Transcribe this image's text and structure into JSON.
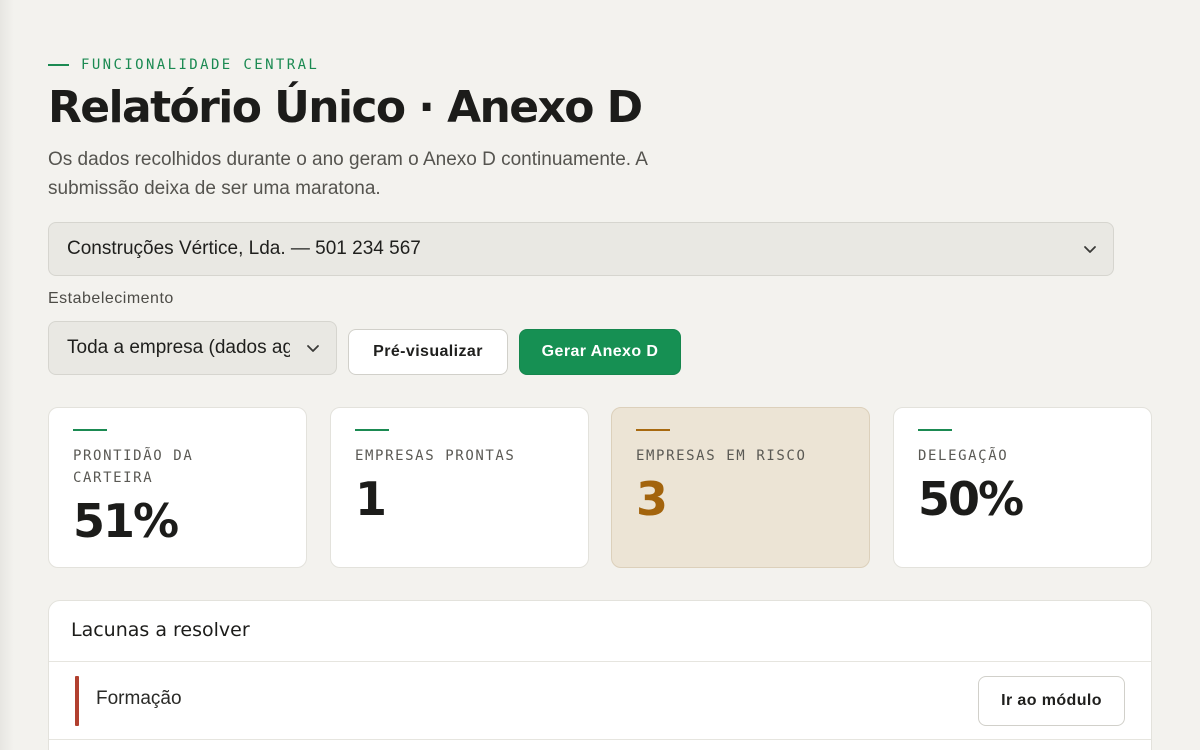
{
  "header": {
    "eyebrow": "FUNCIONALIDADE CENTRAL",
    "title": "Relatório Único · Anexo D",
    "subtitle": "Os dados recolhidos durante o ano geram o Anexo D continuamente. A submissão deixa de ser uma maratona."
  },
  "company_select": {
    "value": "Construções Vértice, Lda. — 501 234 567"
  },
  "establishment": {
    "label": "Estabelecimento",
    "value": "Toda a empresa (dados agregados)"
  },
  "actions": {
    "preview_label": "Pré-visualizar",
    "generate_label": "Gerar Anexo D"
  },
  "stats": [
    {
      "label": "PRONTIDÃO DA CARTEIRA",
      "value": "51%"
    },
    {
      "label": "EMPRESAS PRONTAS",
      "value": "1"
    },
    {
      "label": "EMPRESAS EM RISCO",
      "value": "3"
    },
    {
      "label": "DELEGAÇÃO",
      "value": "50%"
    }
  ],
  "gaps": {
    "title": "Lacunas a resolver",
    "rows": [
      {
        "name": "Formação",
        "action_label": "Ir ao módulo"
      }
    ]
  },
  "colors": {
    "accent_green": "#169053",
    "risk_amber": "#a3640d",
    "severity_red": "#b1402f",
    "background": "#f3f2ee"
  }
}
